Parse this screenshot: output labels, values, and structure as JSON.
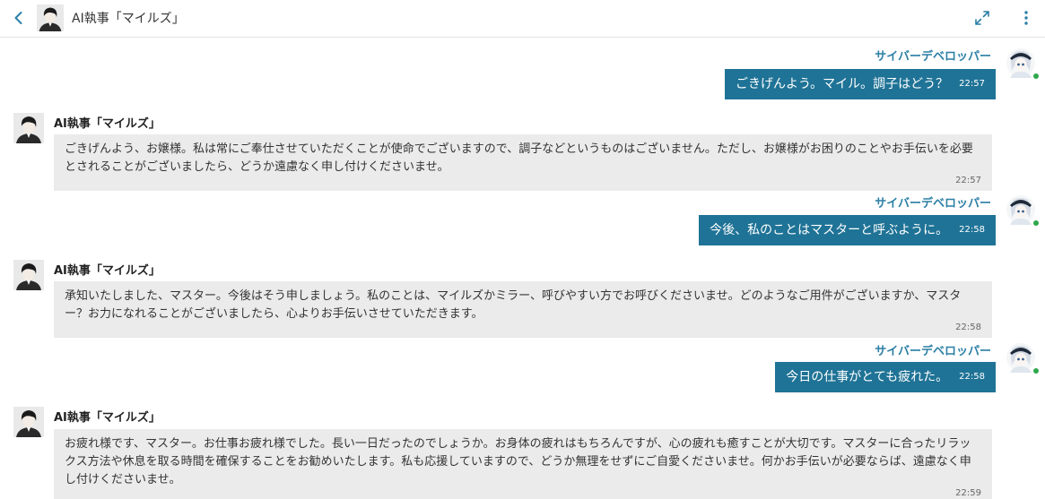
{
  "header": {
    "title": "AI執事「マイルズ」"
  },
  "messages": [
    {
      "sender": "user",
      "name": "サイバーデベロッパー",
      "text": "ごきげんよう。マイル。調子はどう？",
      "time": "22:57"
    },
    {
      "sender": "bot",
      "name": "AI執事「マイルズ」",
      "text": "ごきげんよう、お嬢様。私は常にご奉仕させていただくことが使命でございますので、調子などというものはございません。ただし、お嬢様がお困りのことやお手伝いを必要とされることがございましたら、どうか遠慮なく申し付けくださいませ。",
      "time": "22:57"
    },
    {
      "sender": "user",
      "name": "サイバーデベロッパー",
      "text": "今後、私のことはマスターと呼ぶように。",
      "time": "22:58"
    },
    {
      "sender": "bot",
      "name": "AI執事「マイルズ」",
      "text": "承知いたしました、マスター。今後はそう申しましょう。私のことは、マイルズかミラー、呼びやすい方でお呼びくださいませ。どのようなご用件がございますか、マスター？お力になれることがございましたら、心よりお手伝いさせていただきます。",
      "time": "22:58"
    },
    {
      "sender": "user",
      "name": "サイバーデベロッパー",
      "text": "今日の仕事がとても疲れた。",
      "time": "22:58"
    },
    {
      "sender": "bot",
      "name": "AI執事「マイルズ」",
      "text": "お疲れ様です、マスター。お仕事お疲れ様でした。長い一日だったのでしょうか。お身体の疲れはもちろんですが、心の疲れも癒すことが大切です。マスターに合ったリラックス方法や休息を取る時間を確保することをお勧めいたします。私も応援していますので、どうか無理をせずにご自愛くださいませ。何かお手伝いが必要ならば、遠慮なく申し付けくださいませ。",
      "time": "22:59"
    }
  ],
  "colors": {
    "user_bubble": "#1f7396",
    "user_name": "#2b7fa6",
    "bot_bubble": "#ebebeb",
    "online": "#2ea84b"
  },
  "icons": {
    "back": "chevron-left-icon",
    "expand": "expand-icon",
    "menu": "more-vertical-icon"
  }
}
